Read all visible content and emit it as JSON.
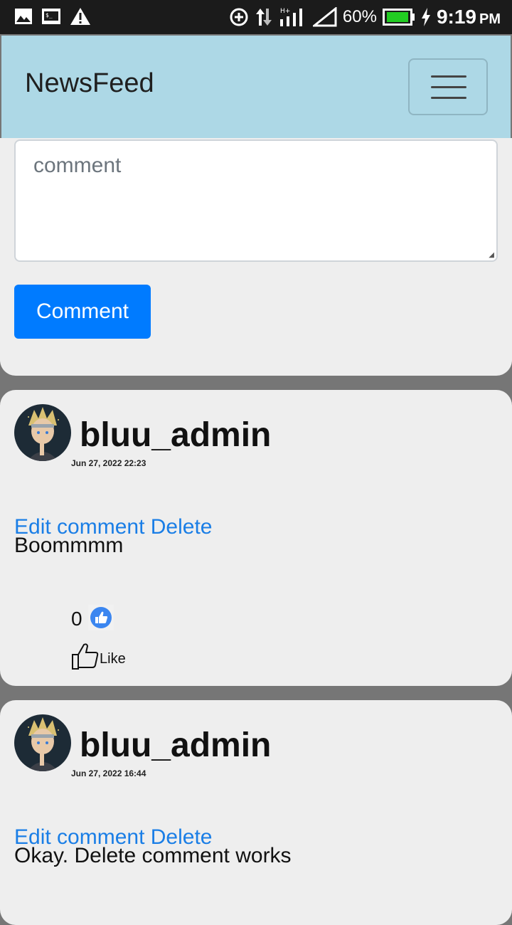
{
  "status_bar": {
    "signal_label": "H+",
    "battery_percent": "60%",
    "time": "9:19",
    "ampm": "PM",
    "battery_color": "#22cc22"
  },
  "navbar": {
    "brand": "NewsFeed",
    "background": "#add8e6"
  },
  "comment_form": {
    "placeholder": "comment",
    "button_label": "Comment",
    "button_color": "#007bff"
  },
  "posts": [
    {
      "username": "bluu_admin",
      "date": "Jun 27, 2022 22:23",
      "edit_label": "Edit comment",
      "delete_label": "Delete",
      "text": "Boommmm",
      "like_count": "0",
      "like_label": "Like"
    },
    {
      "username": "bluu_admin",
      "date": "Jun 27, 2022 16:44",
      "edit_label": "Edit comment",
      "delete_label": "Delete",
      "text": "Okay. Delete comment works"
    }
  ],
  "icons": {
    "status_left": [
      "image-icon",
      "terminal-icon",
      "warning-icon"
    ],
    "status_right": [
      "data-saver-icon",
      "data-transfer-icon",
      "signal-bars-icon",
      "signal-triangle-icon",
      "battery-icon",
      "charging-bolt-icon"
    ],
    "toggler": "hamburger-icon",
    "like_badge": "thumbs-up-badge-icon",
    "like_button": "thumbs-up-outline-icon"
  }
}
